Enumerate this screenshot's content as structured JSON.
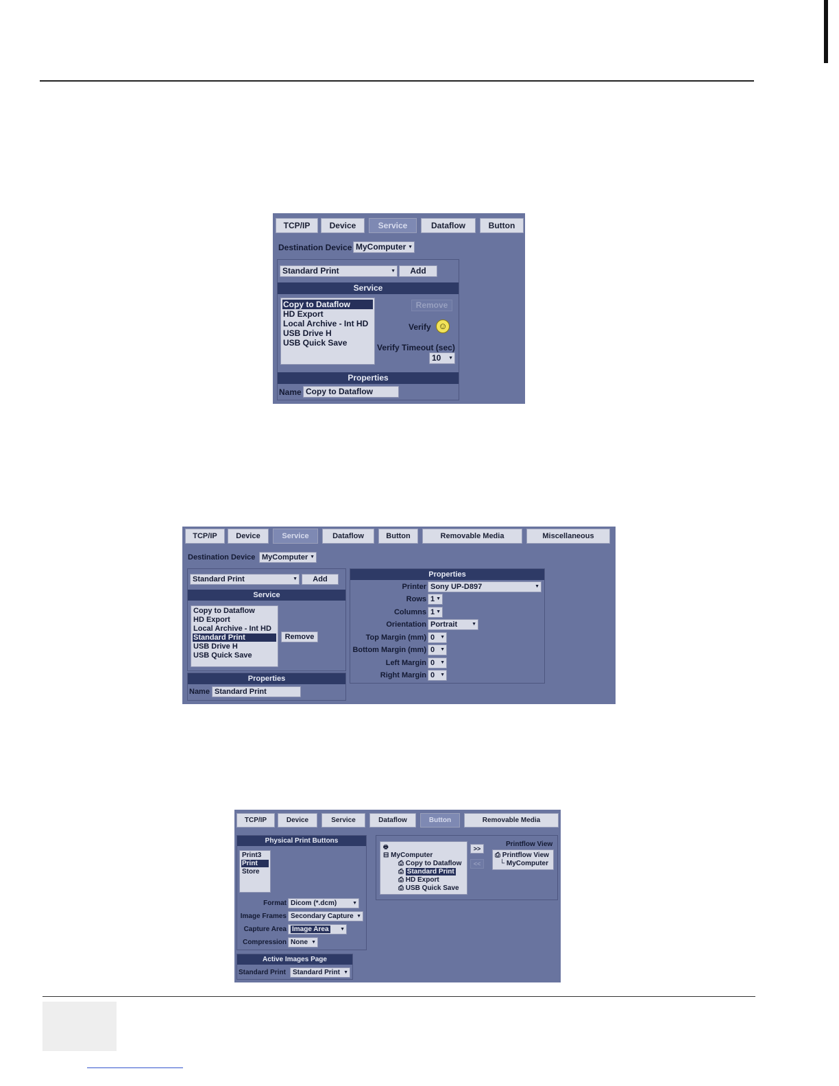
{
  "screen1": {
    "tabs": [
      "TCP/IP",
      "Device",
      "Service",
      "Dataflow",
      "Button"
    ],
    "active_tab": "Service",
    "dest_label": "Destination Device",
    "dest_value": "MyComputer",
    "service_select": "Standard Print",
    "add_label": "Add",
    "service_header": "Service",
    "service_list": [
      "Copy to Dataflow",
      "HD Export",
      "Local Archive - Int HD",
      "USB Drive H",
      "USB Quick Save"
    ],
    "selected_service": "Copy to Dataflow",
    "remove_label": "Remove",
    "verify_label": "Verify",
    "verify_icon": "smiley-face-icon",
    "timeout_label": "Verify Timeout (sec)",
    "timeout_value": "10",
    "properties_header": "Properties",
    "name_label": "Name",
    "name_value": "Copy to Dataflow"
  },
  "screen2": {
    "tabs": [
      "TCP/IP",
      "Device",
      "Service",
      "Dataflow",
      "Button",
      "Removable Media",
      "Miscellaneous"
    ],
    "active_tab": "Service",
    "dest_label": "Destination Device",
    "dest_value": "MyComputer",
    "service_select": "Standard Print",
    "add_label": "Add",
    "service_header": "Service",
    "service_list": [
      "Copy to Dataflow",
      "HD Export",
      "Local Archive - Int HD",
      "Standard Print",
      "USB Drive H",
      "USB Quick Save"
    ],
    "selected_service": "Standard Print",
    "remove_label": "Remove",
    "properties_header": "Properties",
    "name_label": "Name",
    "name_value": "Standard Print",
    "props": [
      {
        "label": "Printer",
        "value": "Sony UP-D897"
      },
      {
        "label": "Rows",
        "value": "1"
      },
      {
        "label": "Columns",
        "value": "1"
      },
      {
        "label": "Orientation",
        "value": "Portrait"
      },
      {
        "label": "Top Margin (mm)",
        "value": "0"
      },
      {
        "label": "Bottom Margin (mm)",
        "value": "0"
      },
      {
        "label": "Left Margin",
        "value": "0"
      },
      {
        "label": "Right Margin",
        "value": "0"
      }
    ]
  },
  "screen3": {
    "tabs": [
      "TCP/IP",
      "Device",
      "Service",
      "Dataflow",
      "Button",
      "Removable Media"
    ],
    "active_tab": "Button",
    "buttons_header": "Physical Print Buttons",
    "button_list": [
      "Print3",
      "Print",
      "Store"
    ],
    "selected_button": "Print",
    "fields": [
      {
        "label": "Format",
        "value": "Dicom (*.dcm)"
      },
      {
        "label": "Image Frames",
        "value": "Secondary Capture"
      },
      {
        "label": "Capture Area",
        "value": "Image Area"
      },
      {
        "label": "Compression",
        "value": "None"
      }
    ],
    "active_images_header": "Active Images Page",
    "active_images_label": "Standard Print",
    "active_images_value": "Standard Print",
    "tree_root": "MyComputer",
    "tree_items": [
      "Copy to Dataflow",
      "Standard Print",
      "HD Export",
      "USB Quick Save"
    ],
    "tree_selected": "Standard Print",
    "move_right": ">>",
    "move_left": "<<",
    "printflow_header": "Printflow View",
    "printflow_items": [
      "Printflow View",
      "MyComputer"
    ]
  }
}
